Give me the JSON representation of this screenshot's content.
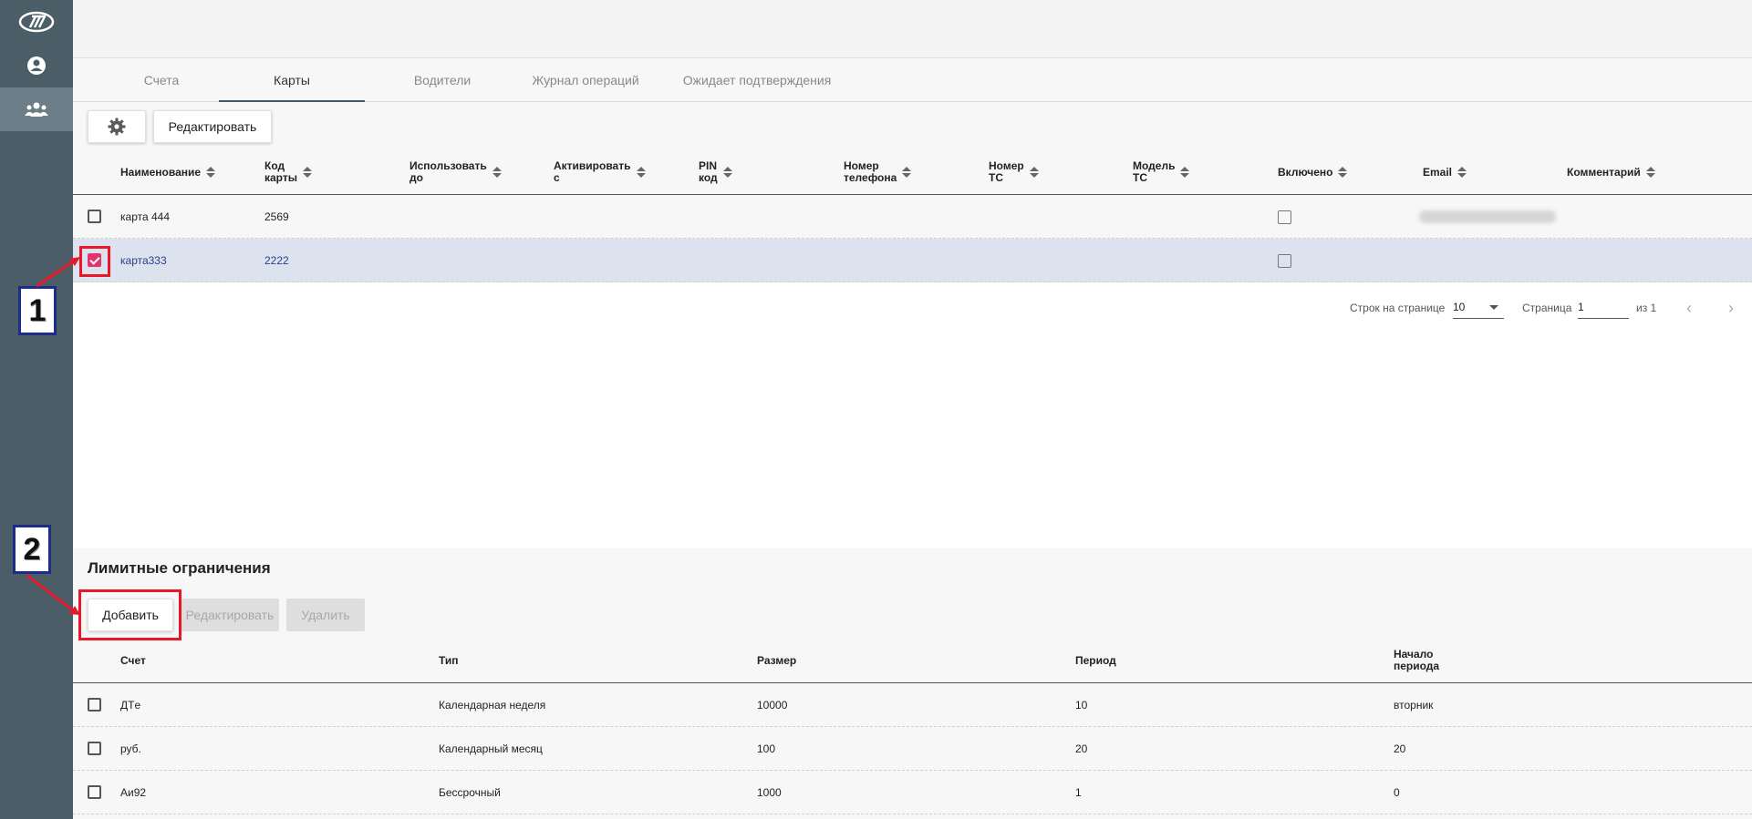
{
  "tabs": [
    "Счета",
    "Карты",
    "Водители",
    "Журнал операций",
    "Ожидает подтверждения"
  ],
  "active_tab": "Карты",
  "toolbar": {
    "settings_icon": "gear-icon",
    "edit_label": "Редактировать"
  },
  "cards_table": {
    "headers": {
      "name": "Наименование",
      "code_1": "Код",
      "code_2": "карты",
      "use_until_1": "Использовать",
      "use_until_2": "до",
      "activate_1": "Активировать",
      "activate_2": "с",
      "pin_1": "PIN",
      "pin_2": "код",
      "phone_1": "Номер",
      "phone_2": "телефона",
      "vehicle_1": "Номер",
      "vehicle_2": "ТС",
      "model_1": "Модель",
      "model_2": "ТС",
      "enabled": "Включено",
      "email": "Email",
      "comment": "Комментарий"
    },
    "rows": [
      {
        "name": "карта 444",
        "code": "2569",
        "selected": false
      },
      {
        "name": "карта333",
        "code": "2222",
        "selected": true
      }
    ]
  },
  "pagination": {
    "rows_per_page_label": "Строк на странице",
    "rows_per_page": "10",
    "page_label": "Страница",
    "page": "1",
    "of_label": "из 1"
  },
  "limits": {
    "title": "Лимитные ограничения",
    "add_label": "Добавить",
    "edit_label": "Редактировать",
    "delete_label": "Удалить",
    "headers": {
      "account": "Счет",
      "type": "Тип",
      "size": "Размер",
      "period": "Период",
      "start_1": "Начало",
      "start_2": "периода"
    },
    "rows": [
      {
        "account": "ДТe",
        "type": "Календарная неделя",
        "size": "10000",
        "period": "10",
        "start": "вторник"
      },
      {
        "account": "руб.",
        "type": "Календарный месяц",
        "size": "100",
        "period": "20",
        "start": "20"
      },
      {
        "account": "Аи92",
        "type": "Бессрочный",
        "size": "1000",
        "period": "1",
        "start": "0"
      }
    ]
  },
  "annotations": {
    "one": "1",
    "two": "2"
  },
  "colors": {
    "sidebar": "#4b5d66",
    "accent_check": "#e2346a",
    "annotation_red": "#e8182a",
    "annotation_blue": "#1b2c8a",
    "selected_row": "#dde2ef"
  }
}
